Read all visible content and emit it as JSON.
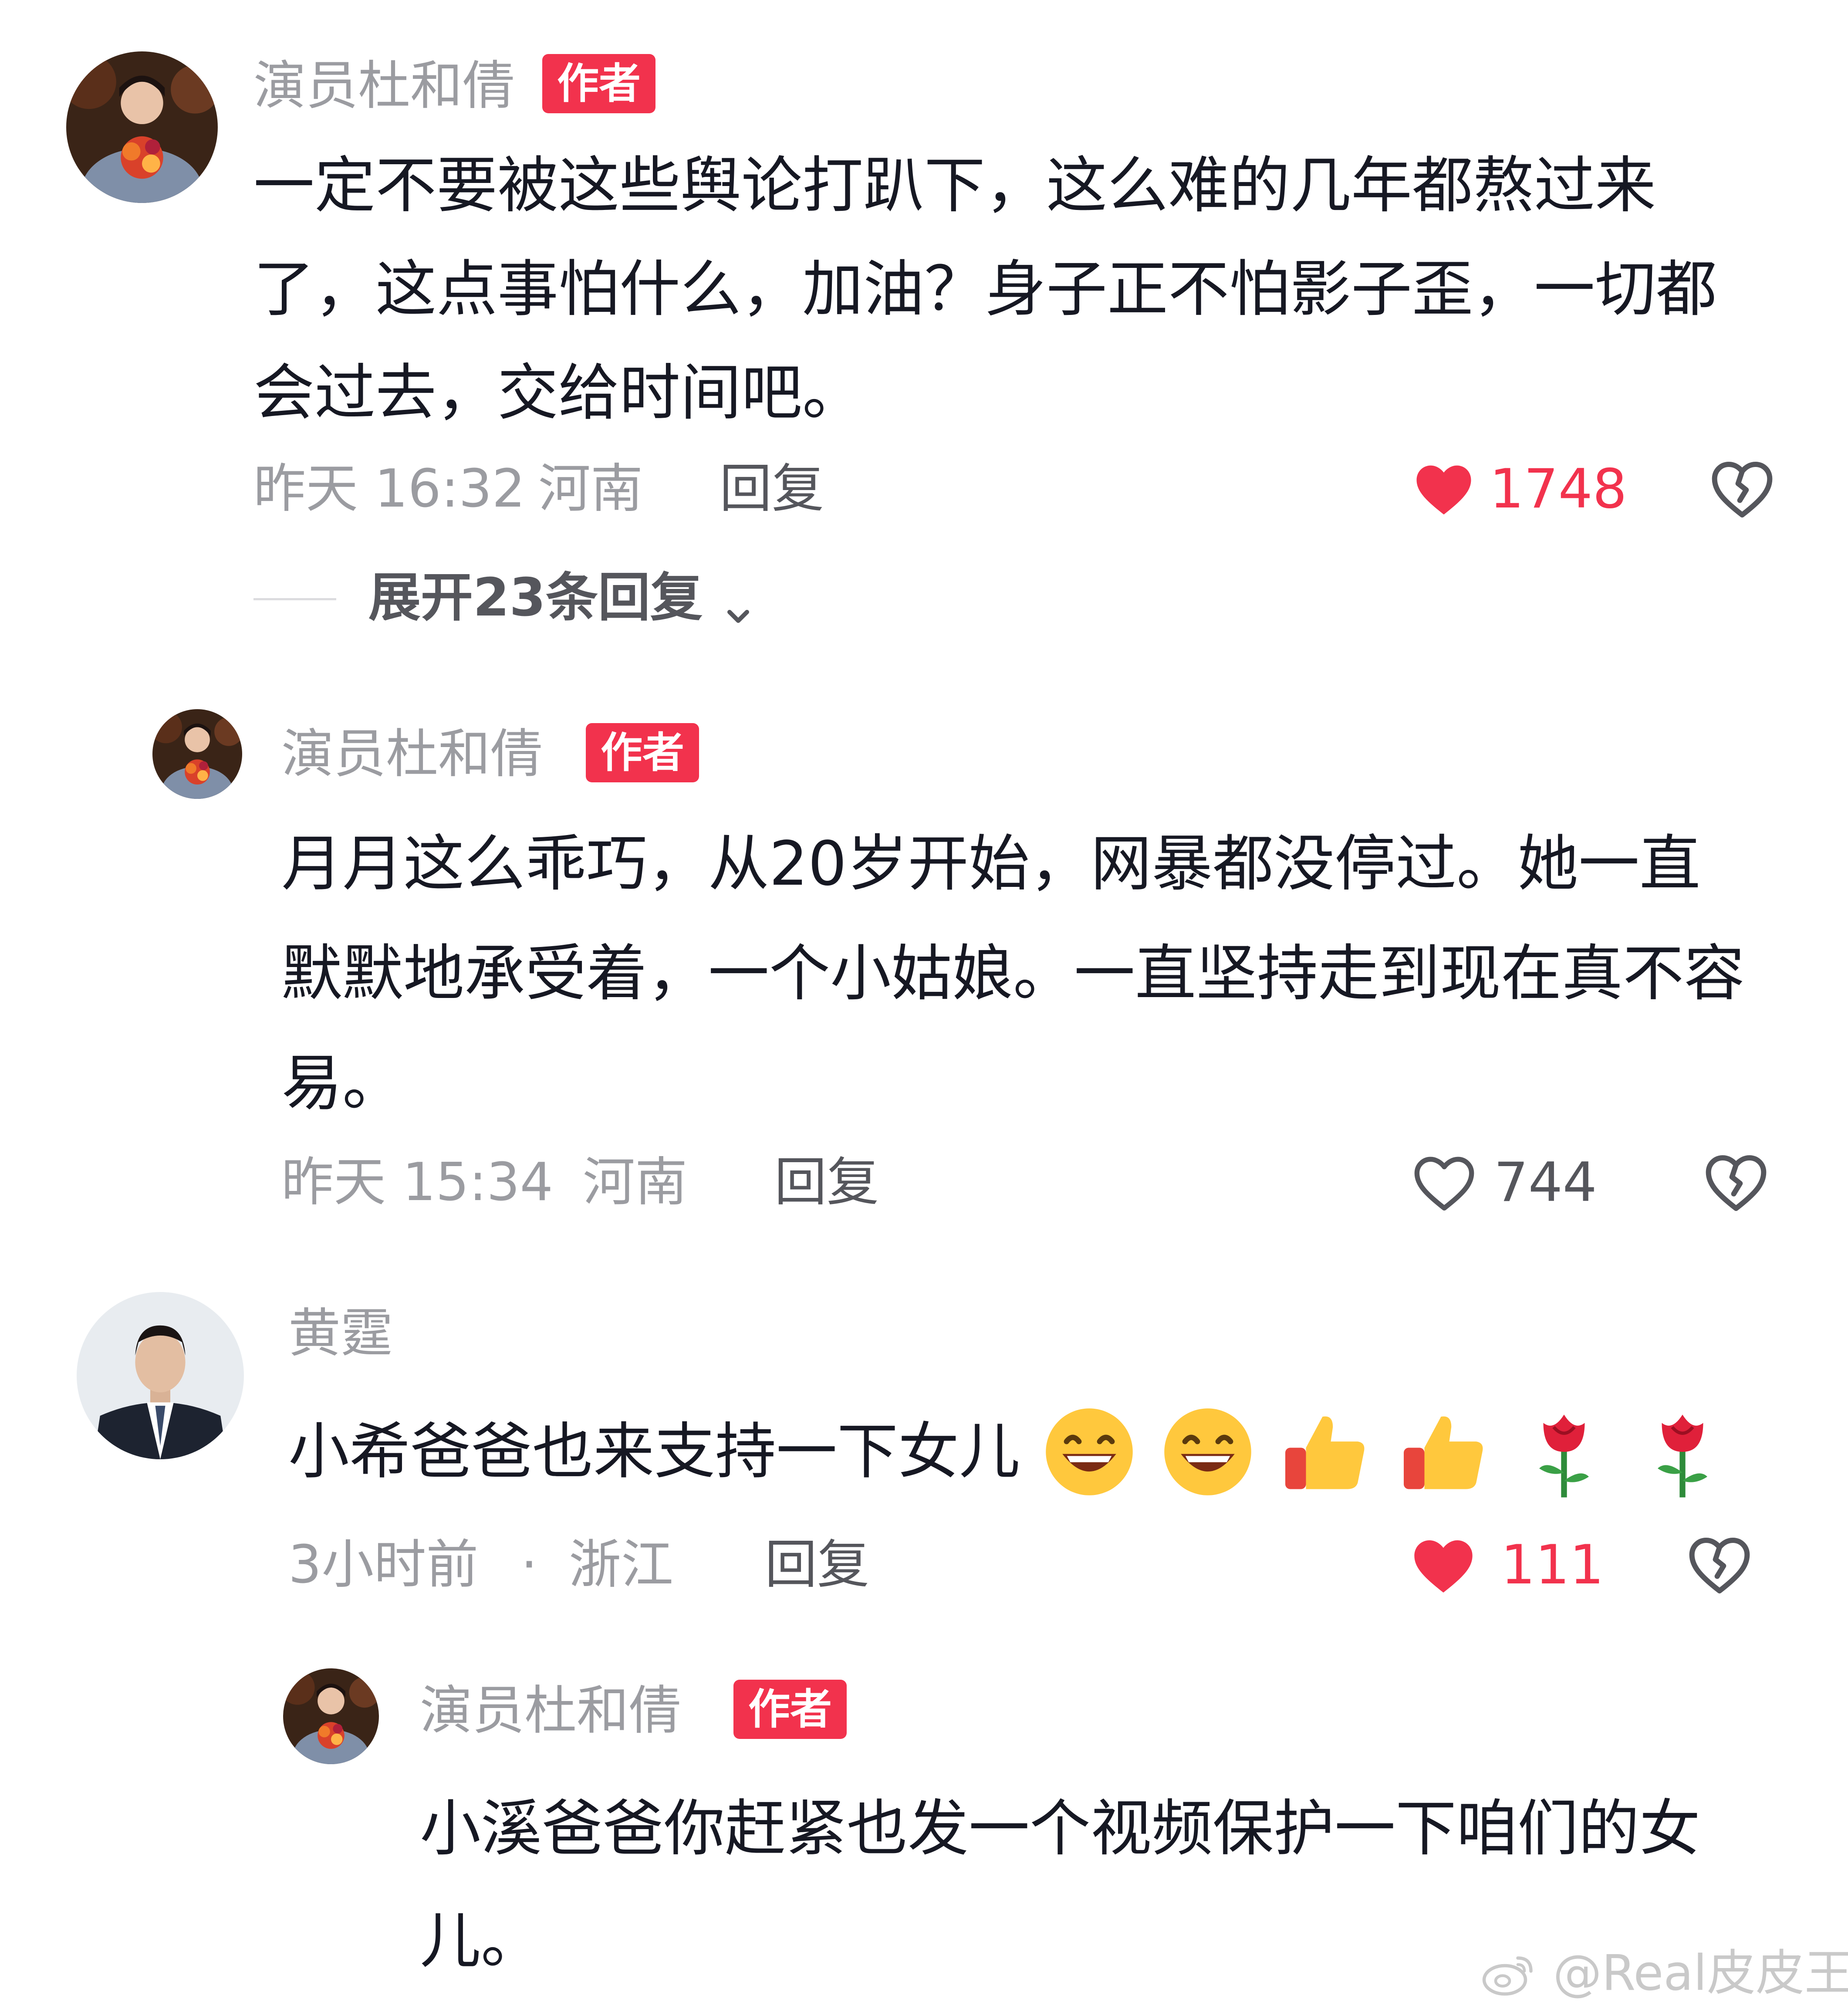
{
  "colors": {
    "accent_red": "#f2324d",
    "muted_gray": "#9b9ca1",
    "text_dark": "#161823"
  },
  "comments": [
    {
      "username": "演员杜和倩",
      "badge": "作者",
      "avatar_icon": "avatar-photo-woman-bouquet",
      "text": "一定不要被这些舆论打趴下，这么难的几年都熬过来了，这点事怕什么，加油？身子正不怕影子歪，一切都会过去，交给时间吧。",
      "time": "昨天 16:32",
      "location": "河南",
      "reply_label": "回复",
      "likes": "1748",
      "liked": true,
      "like_icon": "heart-icon",
      "dislike_icon": "broken-heart-icon"
    },
    {
      "username": "演员杜和倩",
      "badge": "作者",
      "avatar_icon": "avatar-photo-woman-bouquet",
      "text": "月月这么乖巧，从20岁开始，网暴都没停过。她一直默默地承受着，一个小姑娘。一直坚持走到现在真不容易。",
      "time": "昨天 15:34",
      "location": "河南",
      "reply_label": "回复",
      "likes": "744",
      "liked": false,
      "like_icon": "heart-outline-icon",
      "dislike_icon": "broken-heart-icon"
    },
    {
      "username": "黄霆",
      "avatar_icon": "avatar-photo-man-suit",
      "text": "小希爸爸也来支持一下女儿",
      "emojis": [
        "grin-emoji",
        "grin-emoji",
        "thumbs-up-emoji",
        "thumbs-up-emoji",
        "rose-emoji",
        "rose-emoji"
      ],
      "time": "3小时前",
      "separator": "·",
      "location": "浙江",
      "reply_label": "回复",
      "likes": "111",
      "liked": true,
      "like_icon": "heart-icon",
      "dislike_icon": "broken-heart-icon"
    },
    {
      "username": "演员杜和倩",
      "badge": "作者",
      "avatar_icon": "avatar-photo-woman-bouquet",
      "text": "小溪爸爸你赶紧也发一个视频保护一下咱们的女儿。"
    }
  ],
  "expand_replies": {
    "label": "展开23条回复",
    "icon": "chevron-down-icon"
  },
  "watermark": {
    "icon": "weibo-logo-icon",
    "text": "@Real皮皮王"
  }
}
